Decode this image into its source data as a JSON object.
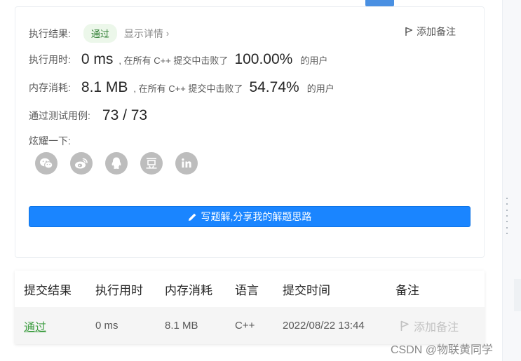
{
  "result": {
    "label": "执行结果:",
    "status": "通过",
    "detail_link": "显示详情",
    "detail_chevron": "›",
    "add_note": "添加备注"
  },
  "runtime": {
    "label": "执行用时:",
    "value": "0 ms",
    "text": ", 在所有 C++ 提交中击败了",
    "percent": "100.00%",
    "suffix": "的用户"
  },
  "memory": {
    "label": "内存消耗:",
    "value": "8.1 MB",
    "text": ", 在所有 C++ 提交中击败了",
    "percent": "54.74%",
    "suffix": "的用户"
  },
  "tests": {
    "label": "通过测试用例:",
    "value": "73 / 73"
  },
  "share": {
    "label": "炫耀一下:",
    "icons": [
      "wechat-icon",
      "weibo-icon",
      "qq-icon",
      "douban-icon",
      "linkedin-icon"
    ]
  },
  "write_button": "写题解,分享我的解题思路",
  "table": {
    "headers": [
      "提交结果",
      "执行用时",
      "内存消耗",
      "语言",
      "提交时间",
      "备注"
    ],
    "row": {
      "result": "通过",
      "runtime": "0 ms",
      "memory": "8.1 MB",
      "language": "C++",
      "time": "2022/08/22 13:44",
      "note": "添加备注"
    }
  },
  "watermark": "CSDN @物联黄同学",
  "colors": {
    "accent": "#1a85ff",
    "success": "#43a047",
    "badge_bg": "#ecf7ea",
    "icon_gray": "#bdbdbd"
  }
}
